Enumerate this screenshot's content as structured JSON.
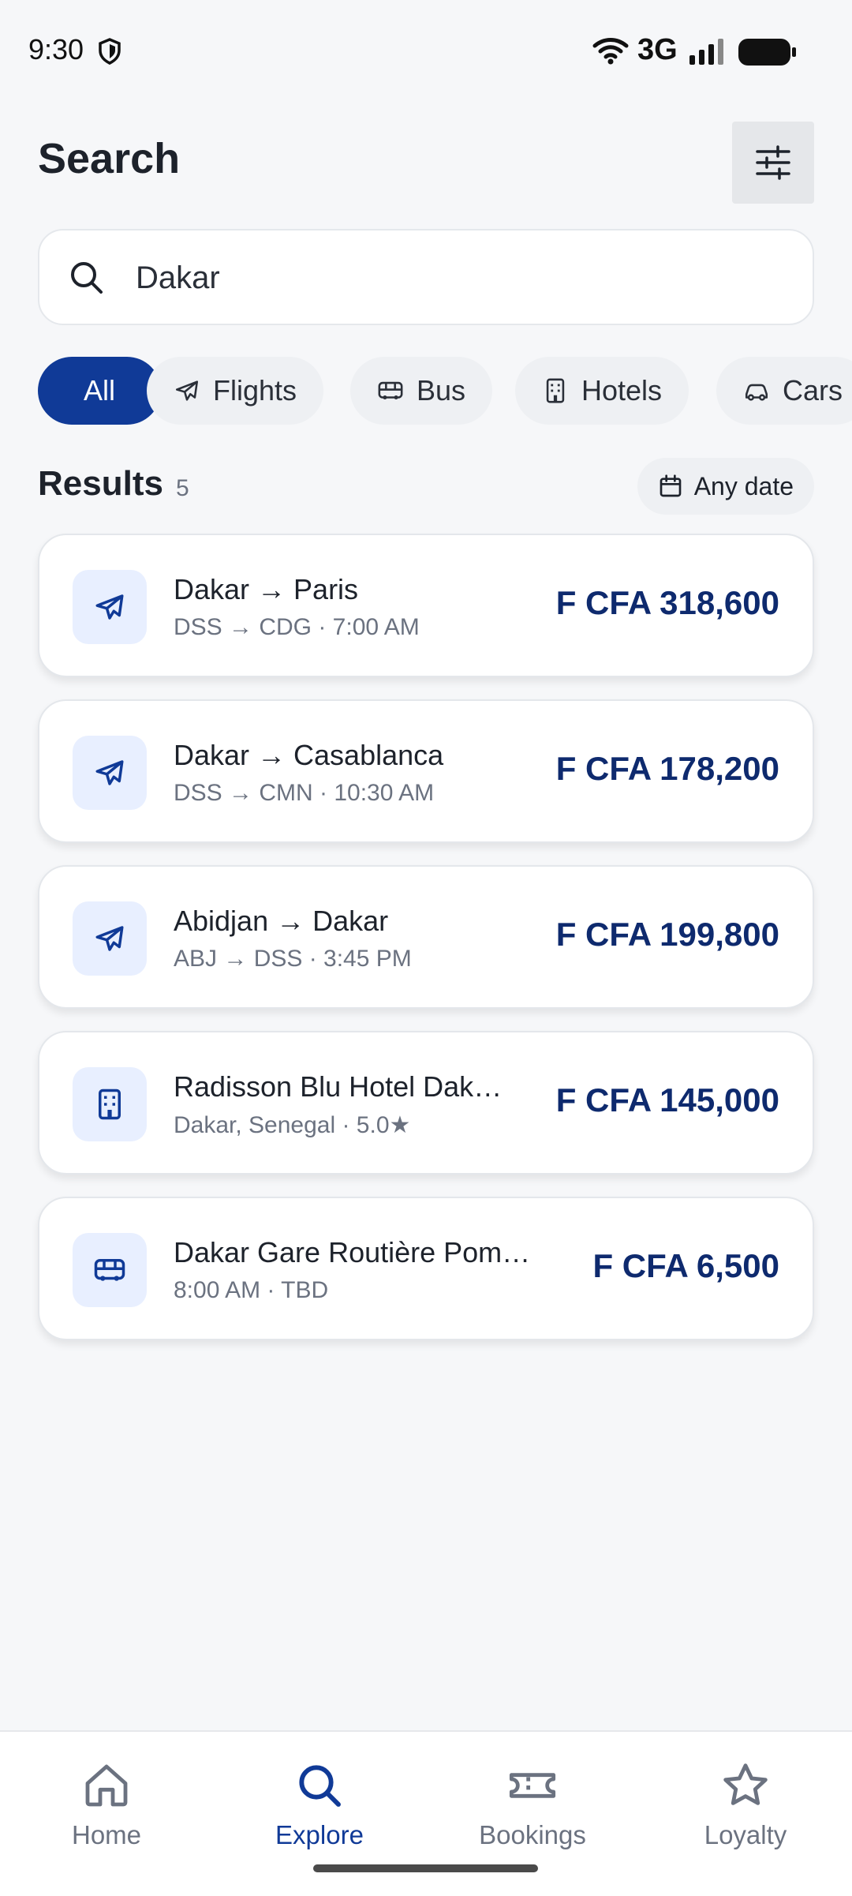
{
  "status_bar": {
    "time": "9:30",
    "network": "3G"
  },
  "header": {
    "title": "Search"
  },
  "search": {
    "value": "Dakar"
  },
  "chips": [
    {
      "label": "All",
      "icon": "none"
    },
    {
      "label": "Flights",
      "icon": "plane-icon"
    },
    {
      "label": "Bus",
      "icon": "bus-icon"
    },
    {
      "label": "Hotels",
      "icon": "building-icon"
    },
    {
      "label": "Cars",
      "icon": "car-icon"
    }
  ],
  "results": {
    "title": "Results",
    "count": "5",
    "date_filter": "Any date",
    "items": [
      {
        "type": "flight",
        "title": "Dakar → Paris",
        "subtitle": "DSS → CDG · 7:00 AM",
        "price": "F CFA 318,600"
      },
      {
        "type": "flight",
        "title": "Dakar → Casablanca",
        "subtitle": "DSS → CMN · 10:30 AM",
        "price": "F CFA 178,200"
      },
      {
        "type": "flight",
        "title": "Abidjan → Dakar",
        "subtitle": "ABJ → DSS · 3:45 PM",
        "price": "F CFA 199,800"
      },
      {
        "type": "hotel",
        "title": "Radisson Blu Hotel Dakar Sea Plaza",
        "subtitle": "Dakar, Senegal · 5.0★",
        "price": "F CFA 145,000"
      },
      {
        "type": "bus",
        "title": "Dakar Gare Routière Pompidou",
        "subtitle": "8:00 AM · TBD",
        "price": "F CFA 6,500"
      }
    ]
  },
  "nav": [
    {
      "label": "Home"
    },
    {
      "label": "Explore"
    },
    {
      "label": "Bookings"
    },
    {
      "label": "Loyalty"
    }
  ],
  "colors": {
    "accent": "#103a97",
    "price": "#0e2a6e",
    "background": "#f6f7f9"
  }
}
